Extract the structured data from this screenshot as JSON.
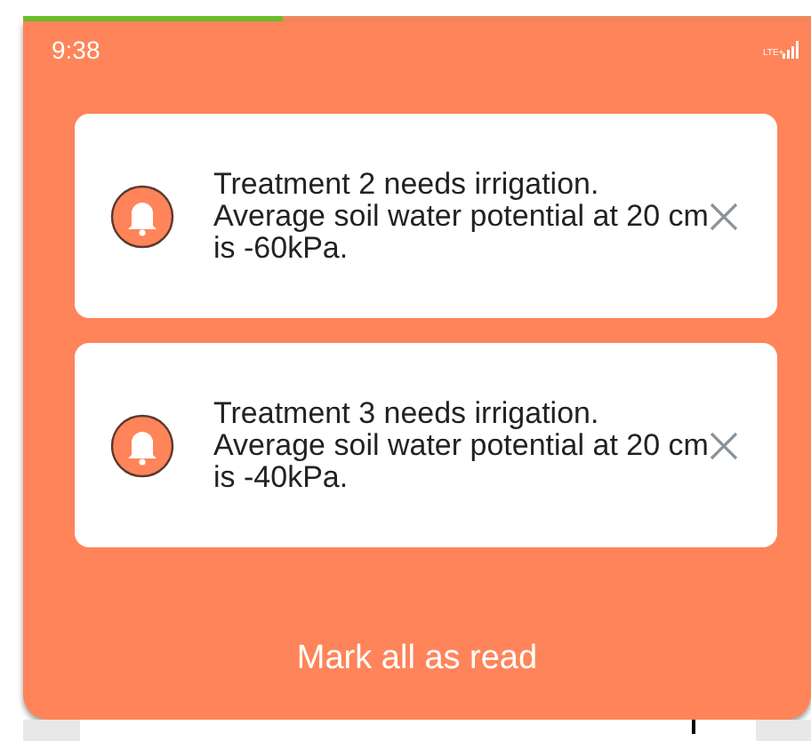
{
  "progress": {
    "level": 0.33
  },
  "status_bar": {
    "time": "9:38",
    "network": "LTE+"
  },
  "notifications": [
    {
      "message": "Treatment 2 needs irrigation. Average soil water potential at 20 cm is -60kPa."
    },
    {
      "message": "Treatment 3 needs irrigation. Average soil water potential at 20 cm is -40kPa."
    }
  ],
  "action": "Mark all as read"
}
